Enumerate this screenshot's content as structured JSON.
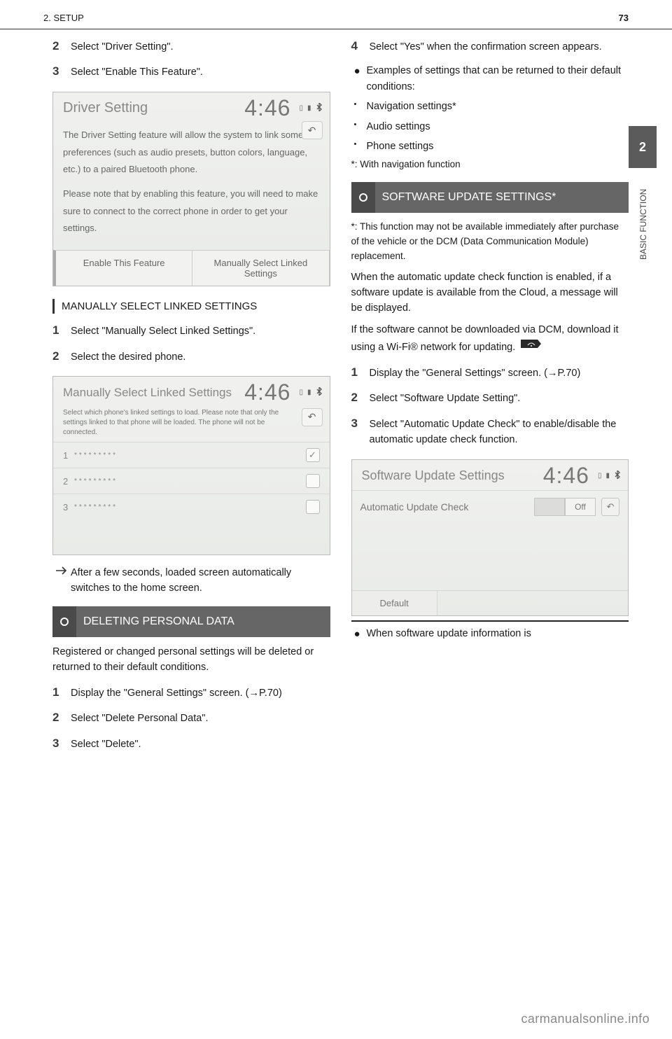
{
  "header": {
    "left": "2. SETUP",
    "right_page": "73"
  },
  "side_tab": {
    "num": "2",
    "label": "BASIC FUNCTION"
  },
  "footer": "carmanualsonline.info",
  "left": {
    "step2": "Select \"Driver Setting\".",
    "step3": "Select \"Enable This Feature\".",
    "subhead_a": "MANUALLY SELECT LINKED SETTINGS",
    "sub_a_step1": "Select \"Manually Select Linked Settings\".",
    "sub_a_step2": "Select the desired phone.",
    "sub_a_after1": "After a few seconds, loaded screen automatically switches to the home screen.",
    "heading_b": "DELETING PERSONAL DATA",
    "b_para": "Registered or changed personal settings will be deleted or returned to their default conditions.",
    "b_step1": "Display the \"General Settings\" screen.",
    "b_step1_ref": "(→P.70)",
    "b_step2": "Select \"Delete Personal Data\".",
    "b_step3": "Select \"Delete\"."
  },
  "right": {
    "step4": "Select \"Yes\" when the confirmation screen appears.",
    "r_bullets": [
      "Examples of settings that can be returned to their default conditions:",
      "Navigation settings*",
      "Audio settings",
      "Phone settings",
      "*: With navigation function"
    ],
    "heading_c": "SOFTWARE UPDATE SETTINGS*",
    "c_note": "*: This function may not be available immediately after purchase of the vehicle or the DCM (Data Communication Module) replacement.",
    "c_para": "When the automatic update check function is enabled, if a software update is available from the Cloud, a message will be displayed.",
    "c_para2": "If the software cannot be downloaded via DCM, download it using a Wi-Fi® network for updating.",
    "c_step1": "Display the \"General Settings\" screen.",
    "c_step1_ref": "(→P.70)",
    "c_step2": "Select \"Software Update Setting\".",
    "c_step3": "Select \"Automatic Update Check\" to enable/disable the automatic update check function.",
    "c_after": "When software update information is"
  },
  "ui_shot1": {
    "title": "Driver Setting",
    "clock": "4:46",
    "body1": "The Driver Setting feature will allow the system to link some preferences (such as audio presets, button colors, language, etc.) to a paired Bluetooth phone.",
    "body2": "Please note that by enabling this feature, you will need to make sure to connect to the correct phone in order to get your settings.",
    "btn1": "Enable This Feature",
    "btn2": "Manually Select Linked Settings"
  },
  "ui_shot2": {
    "title": "Manually Select Linked Settings",
    "clock": "4:46",
    "sub": "Select which phone's linked settings to load. Please note that only the settings linked to that phone will be loaded. The phone will not be connected.",
    "rows": [
      {
        "idx": "1",
        "name": "*********",
        "checked": true
      },
      {
        "idx": "2",
        "name": "*********",
        "checked": false
      },
      {
        "idx": "3",
        "name": "*********",
        "checked": false
      }
    ]
  },
  "ui_shot3": {
    "title": "Software Update Settings",
    "clock": "4:46",
    "row_label": "Automatic Update Check",
    "toggle_off": "Off",
    "default_btn": "Default"
  }
}
